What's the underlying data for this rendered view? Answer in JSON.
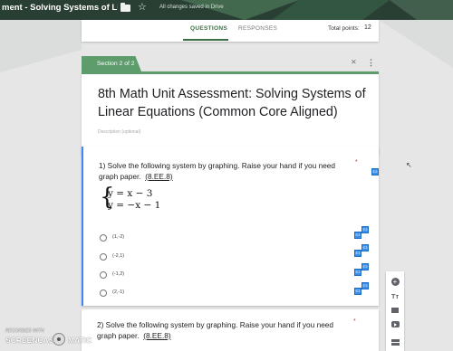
{
  "header": {
    "doc_title": "ment - Solving Systems of Linear E",
    "save_status": "All changes saved in Drive"
  },
  "tabs": {
    "questions": "QUESTIONS",
    "responses": "RESPONSES",
    "total_points_label": "Total points:",
    "total_points_value": "12"
  },
  "section": {
    "label": "Section 2 of 2",
    "title": "8th Math Unit Assessment: Solving Systems of Linear Equations (Common Core Aligned)",
    "description_placeholder": "Description (optional)"
  },
  "question1": {
    "text": "1) Solve the following system by graphing.  Raise your hand if you need graph paper.",
    "standard": "(8.EE.8)",
    "required_mark": "*",
    "equation1": "y = x − 3",
    "equation2": "y = −x − 1",
    "options": [
      "(1,-2)",
      "(-2,1)",
      "(-1,2)",
      "(2,-1)"
    ]
  },
  "question2": {
    "text": "2) Solve the following system by graphing.  Raise your hand if you need graph paper.",
    "standard": "(8.EE.8)",
    "required_mark": "*"
  },
  "tag_label": "E3",
  "watermark": {
    "recorded_with": "RECORDED WITH",
    "brand_left": "SCREENCAST",
    "brand_right": "MATIC"
  },
  "colors": {
    "accent_green": "#5e9d6b",
    "question_active_border": "#4285f4",
    "required_red": "#d93025"
  },
  "icons": [
    "folder-icon",
    "star-icon",
    "collapse-icon",
    "more-vert-icon",
    "add-question-icon",
    "add-title-icon",
    "add-image-icon",
    "add-video-icon",
    "add-section-icon"
  ]
}
